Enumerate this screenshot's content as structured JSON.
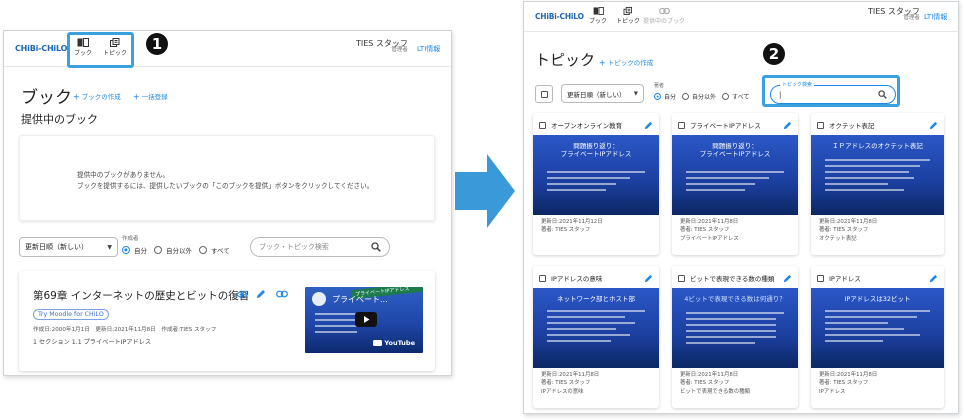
{
  "left": {
    "logo": "CHiBi-CHiLO",
    "nav": [
      {
        "label": "ブック",
        "icon": "book-icon"
      },
      {
        "label": "トピック",
        "icon": "topic-icon"
      }
    ],
    "user": {
      "name": "TIES スタッフ",
      "role": "管理者"
    },
    "lti_label": "LTI情報",
    "step": "1",
    "page_title": "ブック",
    "create_book": "ブックの作成",
    "bulk_register": "一括登録",
    "section_title": "提供中のブック",
    "empty_line1": "提供中のブックがありません。",
    "empty_line2": "ブックを提供するには、提供したいブックの「このブックを提供」ボタンをクリックしてください。",
    "sort_value": "更新日順（新しい）",
    "author_legend": "作成者",
    "radio_options": [
      "自分",
      "自分以外",
      "すべて"
    ],
    "search_placeholder": "ブック・トピック検索",
    "book": {
      "title": "第69章 インターネットの歴史とビットの復習",
      "chip": "Try Moodle for CHiLO",
      "meta_line1": "作成日:2000年1月1日　更新日:2021年11月8日　作成者:TIES スタッフ",
      "meta_line2": "1 セクション 1.1 プライベートIPアドレス",
      "video_title": "プライベート...",
      "video_banner": "プライベートIPアドレス",
      "youtube": "YouTube"
    }
  },
  "right": {
    "logo": "CHiBi-CHiLO",
    "nav": [
      {
        "label": "ブック",
        "icon": "book-icon"
      },
      {
        "label": "トピック",
        "icon": "topic-icon"
      },
      {
        "label": "提供中のブック",
        "icon": "link-icon"
      }
    ],
    "user": {
      "name": "TIES スタッフ",
      "role": "管理者"
    },
    "lti_label": "LTI情報",
    "step": "2",
    "page_title": "トピック",
    "create_topic": "トピックの作成",
    "sort_value": "更新日順（新しい）",
    "author_legend": "著者",
    "radio_options": [
      "自分",
      "自分以外",
      "すべて"
    ],
    "search_legend": "トピック検索",
    "cards": [
      {
        "title": "オープンオンライン教育",
        "thumb_title": "問題振り返り：\nプライベートIPアドレス",
        "updated": "更新日:2021年11月12日",
        "author": "著者: TIES スタッフ",
        "tag": ""
      },
      {
        "title": "プライベートIPアドレス",
        "thumb_title": "問題振り返り：\nプライベートIPアドレス",
        "updated": "更新日:2021年11月8日",
        "author": "著者: TIES スタッフ",
        "tag": "プライベートIPアドレス"
      },
      {
        "title": "オクテット表記",
        "thumb_title": "ＩＰアドレスのオクテット表記",
        "updated": "更新日:2021年11月8日",
        "author": "著者: TIES スタッフ",
        "tag": "オクテット表記"
      },
      {
        "title": "IPアドレスの意味",
        "thumb_title": "ネットワーク部とホスト部",
        "updated": "更新日:2021年11月8日",
        "author": "著者: TIES スタッフ",
        "tag": "IPアドレスの意味"
      },
      {
        "title": "ビットで表現できる数の種類",
        "thumb_title": "4ビットで表現できる数は何通り？",
        "updated": "更新日:2021年11月8日",
        "author": "著者: TIES スタッフ",
        "tag": "ビットで表現できる数の種類"
      },
      {
        "title": "IPアドレス",
        "thumb_title": "IPアドレスは32ビット",
        "updated": "更新日:2021年11月8日",
        "author": "著者: TIES スタッフ",
        "tag": "IPアドレス"
      }
    ]
  },
  "colors": {
    "accent": "#1e88e5",
    "highlight": "#3aa0e0",
    "arrow": "#3a9ad9",
    "thumb": "#1f46a8"
  }
}
